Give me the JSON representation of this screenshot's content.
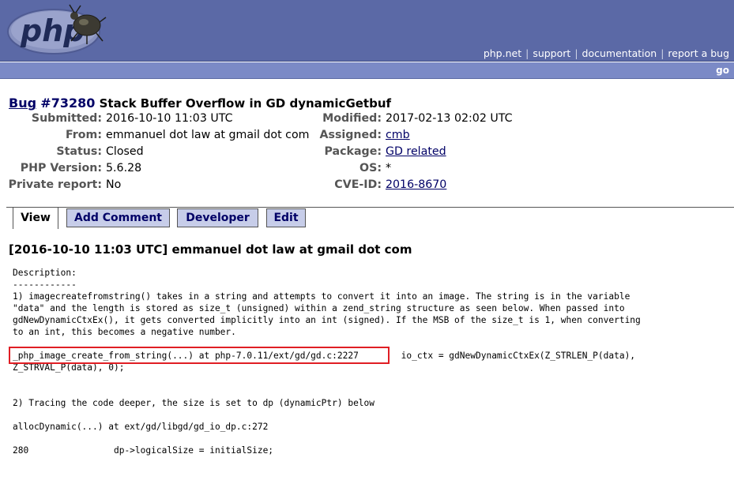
{
  "header": {
    "logo_text": "php",
    "nav": [
      "php.net",
      "support",
      "documentation",
      "report a bug"
    ],
    "nav_separator": "|",
    "go_label": "go"
  },
  "bug": {
    "bug_label": "Bug",
    "number": "#73280",
    "title": "Stack Buffer Overflow in GD dynamicGetbuf"
  },
  "meta_left": [
    {
      "key": "Submitted:",
      "value": "2016-10-10 11:03 UTC"
    },
    {
      "key": "From:",
      "value": "emmanuel dot law at gmail dot com"
    },
    {
      "key": "Status:",
      "value": "Closed"
    },
    {
      "key": "PHP Version:",
      "value": "5.6.28"
    },
    {
      "key": "Private report:",
      "value": "No"
    }
  ],
  "meta_right": [
    {
      "key": "Modified:",
      "value": "2017-02-13 02:02 UTC"
    },
    {
      "key": "Assigned:",
      "value": "cmb"
    },
    {
      "key": "Package:",
      "value": "GD related"
    },
    {
      "key": "OS:",
      "value": "*"
    },
    {
      "key": "CVE-ID:",
      "value": "2016-8670"
    }
  ],
  "tabs": [
    "View",
    "Add Comment",
    "Developer",
    "Edit"
  ],
  "comment": {
    "heading": "[2016-10-10 11:03 UTC] emmanuel dot law at gmail dot com",
    "body": "Description:\n------------\n1) imagecreatefromstring() takes in a string and attempts to convert it into an image. The string is in the variable\n\"data\" and the length is stored as size_t (unsigned) within a zend_string structure as seen below. When passed into\ngdNewDynamicCtxEx(), it gets converted implicitly into an int (signed). If the MSB of the size_t is 1, when converting\nto an int, this becomes a negative number.\n\n_php_image_create_from_string(...) at php-7.0.11/ext/gd/gd.c:2227        io_ctx = gdNewDynamicCtxEx(Z_STRLEN_P(data),\nZ_STRVAL_P(data), 0);\n\n\n2) Tracing the code deeper, the size is set to dp (dynamicPtr) below\n\nallocDynamic(...) at ext/gd/libgd/gd_io_dp.c:272\n\n280                dp->logicalSize = initialSize;"
  },
  "colors": {
    "header_bg": "#5b69a6",
    "subbar_bg": "#7b8ac6",
    "tab_inactive_bg": "#c7cde9",
    "link": "#000066",
    "highlight_box": "#e01e24"
  }
}
